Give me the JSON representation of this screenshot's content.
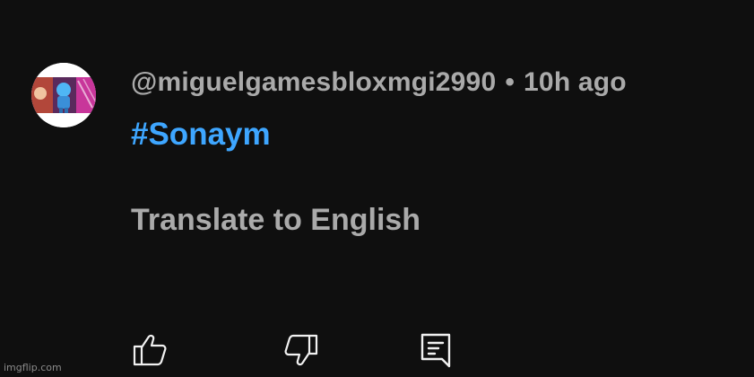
{
  "comment": {
    "author": "@miguelgamesbloxmgi2990",
    "separator": "•",
    "time": "10h ago",
    "hashtag": "#Sonaym",
    "translate_label": "Translate to English",
    "avatar_icon": "profile-avatar",
    "actions": {
      "like_icon": "thumbs-up-icon",
      "dislike_icon": "thumbs-down-icon",
      "reply_icon": "reply-comment-icon"
    }
  },
  "colors": {
    "background": "#0f0f0f",
    "secondary_text": "#aaaaaa",
    "link": "#3ea6ff",
    "icon": "#f1f1f1"
  },
  "watermark": "imgflip.com"
}
